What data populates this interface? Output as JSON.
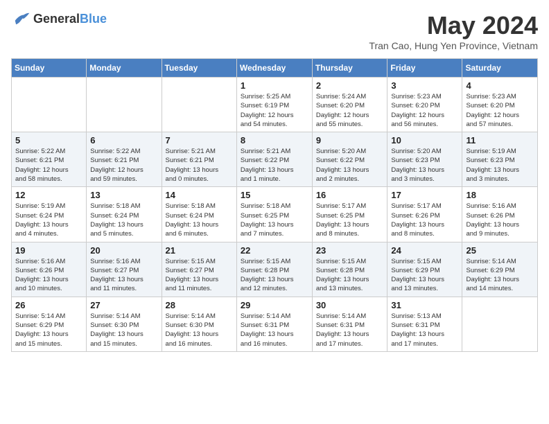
{
  "header": {
    "logo_general": "General",
    "logo_blue": "Blue",
    "month": "May 2024",
    "location": "Tran Cao, Hung Yen Province, Vietnam"
  },
  "weekdays": [
    "Sunday",
    "Monday",
    "Tuesday",
    "Wednesday",
    "Thursday",
    "Friday",
    "Saturday"
  ],
  "weeks": [
    [
      {
        "day": "",
        "detail": ""
      },
      {
        "day": "",
        "detail": ""
      },
      {
        "day": "",
        "detail": ""
      },
      {
        "day": "1",
        "detail": "Sunrise: 5:25 AM\nSunset: 6:19 PM\nDaylight: 12 hours\nand 54 minutes."
      },
      {
        "day": "2",
        "detail": "Sunrise: 5:24 AM\nSunset: 6:20 PM\nDaylight: 12 hours\nand 55 minutes."
      },
      {
        "day": "3",
        "detail": "Sunrise: 5:23 AM\nSunset: 6:20 PM\nDaylight: 12 hours\nand 56 minutes."
      },
      {
        "day": "4",
        "detail": "Sunrise: 5:23 AM\nSunset: 6:20 PM\nDaylight: 12 hours\nand 57 minutes."
      }
    ],
    [
      {
        "day": "5",
        "detail": "Sunrise: 5:22 AM\nSunset: 6:21 PM\nDaylight: 12 hours\nand 58 minutes."
      },
      {
        "day": "6",
        "detail": "Sunrise: 5:22 AM\nSunset: 6:21 PM\nDaylight: 12 hours\nand 59 minutes."
      },
      {
        "day": "7",
        "detail": "Sunrise: 5:21 AM\nSunset: 6:21 PM\nDaylight: 13 hours\nand 0 minutes."
      },
      {
        "day": "8",
        "detail": "Sunrise: 5:21 AM\nSunset: 6:22 PM\nDaylight: 13 hours\nand 1 minute."
      },
      {
        "day": "9",
        "detail": "Sunrise: 5:20 AM\nSunset: 6:22 PM\nDaylight: 13 hours\nand 2 minutes."
      },
      {
        "day": "10",
        "detail": "Sunrise: 5:20 AM\nSunset: 6:23 PM\nDaylight: 13 hours\nand 3 minutes."
      },
      {
        "day": "11",
        "detail": "Sunrise: 5:19 AM\nSunset: 6:23 PM\nDaylight: 13 hours\nand 3 minutes."
      }
    ],
    [
      {
        "day": "12",
        "detail": "Sunrise: 5:19 AM\nSunset: 6:24 PM\nDaylight: 13 hours\nand 4 minutes."
      },
      {
        "day": "13",
        "detail": "Sunrise: 5:18 AM\nSunset: 6:24 PM\nDaylight: 13 hours\nand 5 minutes."
      },
      {
        "day": "14",
        "detail": "Sunrise: 5:18 AM\nSunset: 6:24 PM\nDaylight: 13 hours\nand 6 minutes."
      },
      {
        "day": "15",
        "detail": "Sunrise: 5:18 AM\nSunset: 6:25 PM\nDaylight: 13 hours\nand 7 minutes."
      },
      {
        "day": "16",
        "detail": "Sunrise: 5:17 AM\nSunset: 6:25 PM\nDaylight: 13 hours\nand 8 minutes."
      },
      {
        "day": "17",
        "detail": "Sunrise: 5:17 AM\nSunset: 6:26 PM\nDaylight: 13 hours\nand 8 minutes."
      },
      {
        "day": "18",
        "detail": "Sunrise: 5:16 AM\nSunset: 6:26 PM\nDaylight: 13 hours\nand 9 minutes."
      }
    ],
    [
      {
        "day": "19",
        "detail": "Sunrise: 5:16 AM\nSunset: 6:26 PM\nDaylight: 13 hours\nand 10 minutes."
      },
      {
        "day": "20",
        "detail": "Sunrise: 5:16 AM\nSunset: 6:27 PM\nDaylight: 13 hours\nand 11 minutes."
      },
      {
        "day": "21",
        "detail": "Sunrise: 5:15 AM\nSunset: 6:27 PM\nDaylight: 13 hours\nand 11 minutes."
      },
      {
        "day": "22",
        "detail": "Sunrise: 5:15 AM\nSunset: 6:28 PM\nDaylight: 13 hours\nand 12 minutes."
      },
      {
        "day": "23",
        "detail": "Sunrise: 5:15 AM\nSunset: 6:28 PM\nDaylight: 13 hours\nand 13 minutes."
      },
      {
        "day": "24",
        "detail": "Sunrise: 5:15 AM\nSunset: 6:29 PM\nDaylight: 13 hours\nand 13 minutes."
      },
      {
        "day": "25",
        "detail": "Sunrise: 5:14 AM\nSunset: 6:29 PM\nDaylight: 13 hours\nand 14 minutes."
      }
    ],
    [
      {
        "day": "26",
        "detail": "Sunrise: 5:14 AM\nSunset: 6:29 PM\nDaylight: 13 hours\nand 15 minutes."
      },
      {
        "day": "27",
        "detail": "Sunrise: 5:14 AM\nSunset: 6:30 PM\nDaylight: 13 hours\nand 15 minutes."
      },
      {
        "day": "28",
        "detail": "Sunrise: 5:14 AM\nSunset: 6:30 PM\nDaylight: 13 hours\nand 16 minutes."
      },
      {
        "day": "29",
        "detail": "Sunrise: 5:14 AM\nSunset: 6:31 PM\nDaylight: 13 hours\nand 16 minutes."
      },
      {
        "day": "30",
        "detail": "Sunrise: 5:14 AM\nSunset: 6:31 PM\nDaylight: 13 hours\nand 17 minutes."
      },
      {
        "day": "31",
        "detail": "Sunrise: 5:13 AM\nSunset: 6:31 PM\nDaylight: 13 hours\nand 17 minutes."
      },
      {
        "day": "",
        "detail": ""
      }
    ]
  ]
}
